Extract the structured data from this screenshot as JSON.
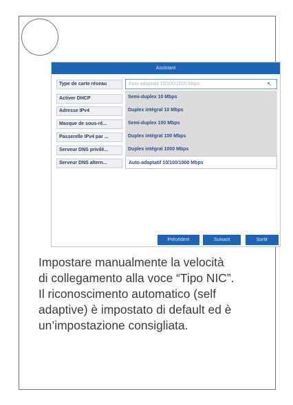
{
  "dialog": {
    "title": "Assistant",
    "fields": [
      {
        "label": "Type de carte réseau"
      },
      {
        "label": "Activer DHCP"
      },
      {
        "label": "Adresse IPv4"
      },
      {
        "label": "Masque de sous-ré..."
      },
      {
        "label": "Passerelle IPv4 par ..."
      },
      {
        "label": "Serveur DNS privilé..."
      },
      {
        "label": "Serveur DNS altern..."
      }
    ],
    "nic_select": {
      "value": "Auto-adaptatif 10/100/1000 Mbps",
      "options": [
        "Semi-duplex 10 Mbps",
        "Duplex intégral 10 Mbps",
        "Semi-duplex 100 Mbps",
        "Duplex intégral 100 Mbps",
        "Duplex intégral 1000 Mbps",
        "Auto-adaptatif 10/100/1000 Mbps"
      ]
    },
    "buttons": {
      "previous": "Précédent",
      "next": "Suivant",
      "exit": "Sortir"
    }
  },
  "caption": {
    "line1": "Impostare manualmente la velocità",
    "line2": "di collegamento alla voce “Tipo NIC”.",
    "line3": "Il riconoscimento automatico (self",
    "line4": "adaptive) è impostato di default ed è",
    "line5": "un’impostazione consigliata."
  },
  "colors": {
    "title_bar": "#1d63b8",
    "option_text": "#2a4b8f",
    "option_highlight": "#dcdcdc"
  }
}
